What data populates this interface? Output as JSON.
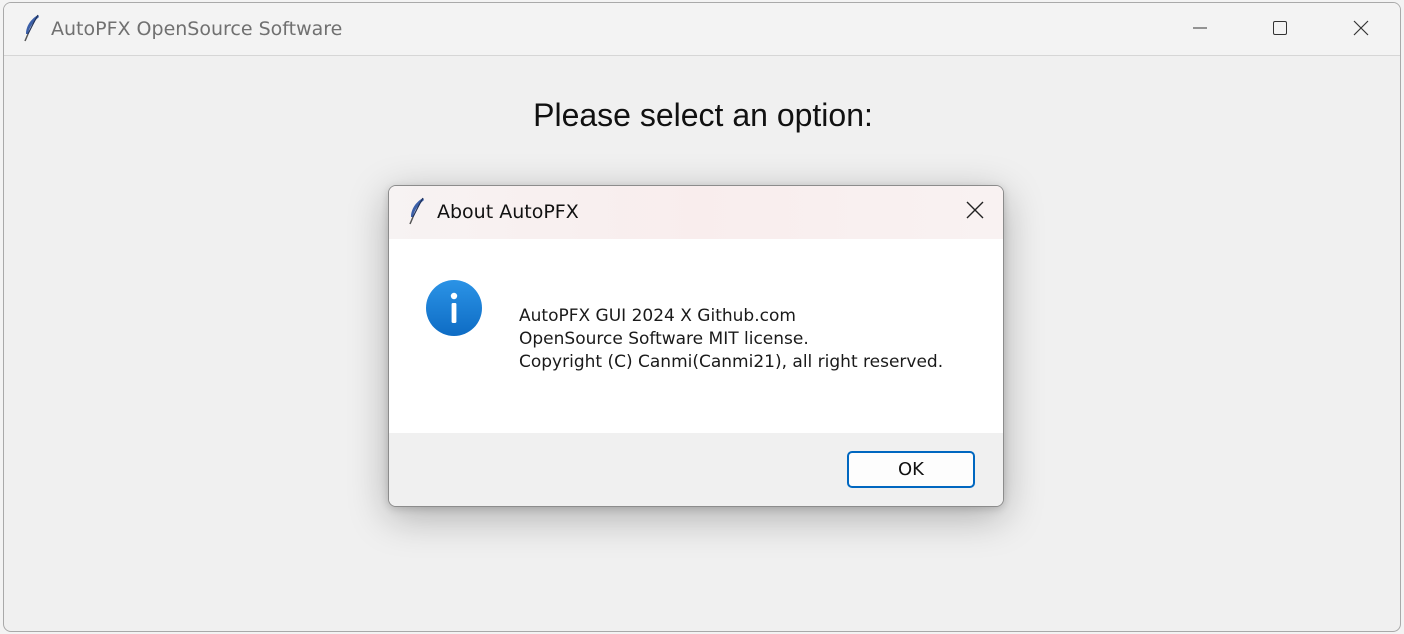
{
  "main_window": {
    "title": "AutoPFX OpenSource Software",
    "app_icon": "feather-icon",
    "controls": {
      "minimize_icon": "minimize-icon",
      "maximize_icon": "maximize-icon",
      "close_icon": "close-icon"
    },
    "prompt": "Please select an option:"
  },
  "dialog": {
    "title": "About AutoPFX",
    "icon": "feather-icon",
    "close_icon": "close-icon",
    "message_icon": "info-icon",
    "message_lines": [
      "AutoPFX GUI 2024 X Github.com",
      "OpenSource Software MIT license.",
      "Copyright (C) Canmi(Canmi21), all right reserved."
    ],
    "ok_label": "OK"
  },
  "colors": {
    "accent": "#0067c0",
    "info_icon": "#1a7fd8"
  }
}
